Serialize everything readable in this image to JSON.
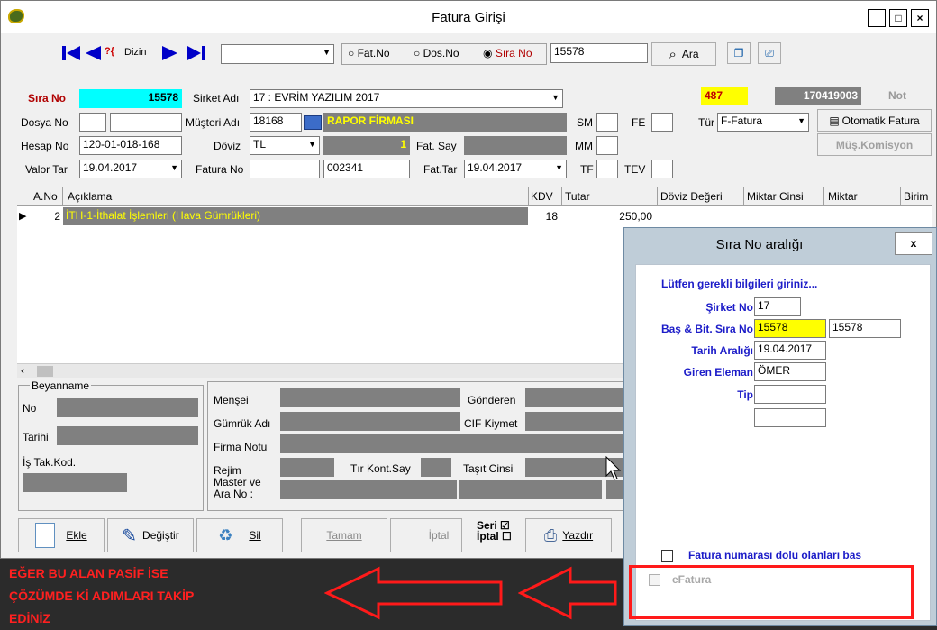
{
  "window": {
    "title": "Fatura Girişi",
    "min": "_",
    "max": "□",
    "close": "×"
  },
  "toolbar": {
    "dizin": "Dizin",
    "search_mode_fatno": "Fat.No",
    "search_mode_dosno": "Dos.No",
    "search_mode_sirano": "Sıra No",
    "search_value": "15578",
    "ara": "Ara"
  },
  "form": {
    "sira_no_label": "Sıra No",
    "sira_no": "15578",
    "sirket_label": "Sirket Adı",
    "sirket": "17 : EVRİM YAZILIM 2017",
    "code_yellow": "487",
    "code_gray": "170419003",
    "not_label": "Not",
    "dosya_label": "Dosya No",
    "musteri_label": "Müşteri Adı",
    "musteri_kod": "18168",
    "musteri_ad": "RAPOR FİRMASI",
    "sm_label": "SM",
    "fe_label": "FE",
    "tur_label": "Tür",
    "tur": "F-Fatura",
    "otomatik_fatura": "Otomatik Fatura",
    "hesap_label": "Hesap No",
    "hesap": "120-01-018-168",
    "doviz_label": "Döviz",
    "doviz": "TL",
    "doviz_val": "1",
    "fatsay_label": "Fat. Say",
    "mm_label": "MM",
    "mus_komisyon": "Müş.Komisyon",
    "valor_label": "Valor Tar",
    "valor": "19.04.2017",
    "fatura_no_label": "Fatura No",
    "fatura_no2": "002341",
    "fat_tar_label": "Fat.Tar",
    "fat_tar": "19.04.2017",
    "tf_label": "TF",
    "tev_label": "TEV"
  },
  "grid": {
    "headers": [
      "A.No",
      "Açıklama",
      "KDV",
      "Tutar",
      "Döviz Değeri",
      "Miktar Cinsi",
      "Miktar",
      "Birim"
    ],
    "row": {
      "ano": "2",
      "aciklama": "İTH-1-İthalat İşlemleri  (Hava Gümrükleri)",
      "kdv": "18",
      "tutar": "250,00"
    }
  },
  "beyanname": {
    "title": "Beyanname",
    "no": "No",
    "tarihi": "Tarihi",
    "is_tak": "İş Tak.Kod.",
    "mensei": "Menşei",
    "gumruk": "Gümrük Adı",
    "firma_notu": "Firma Notu",
    "rejim": "Rejim",
    "master": "Master ve Ara No :",
    "gonderen": "Gönderen",
    "cif": "CIF Kiymet",
    "tir": "Tır Kont.Say",
    "tasit": "Taşıt Cinsi"
  },
  "actions": {
    "ekle": "Ekle",
    "degistir": "Değiştir",
    "sil": "Sil",
    "tamam": "Tamam",
    "iptal": "İptal",
    "seri": "Seri",
    "iptal2": "İptal",
    "yazdir": "Yazdır"
  },
  "note": {
    "line1": "EĞER BU ALAN PASİF İSE",
    "line2": "ÇÖZÜMDE Kİ ADIMLARI TAKİP",
    "line3": "EDİNİZ"
  },
  "dialog": {
    "title": "Sıra No aralığı",
    "close": "x",
    "prompt": "Lütfen gerekli bilgileri  giriniz...",
    "sirket_label": "Şirket No",
    "sirket": "17",
    "bas_bit_label": "Baş & Bit. Sıra No",
    "bas": "15578",
    "bit": "15578",
    "tarih_label": "Tarih Aralığı",
    "tarih": "19.04.2017",
    "giren_label": "Giren Eleman",
    "giren": "ÖMER",
    "tip_label": "Tip",
    "dolu_label": "Fatura numarası  dolu olanları bas",
    "efatura_label": "eFatura"
  },
  "colors": {
    "cyan": "#00ffff",
    "yellow": "#ffff00",
    "highlight": "#ff0000",
    "label_red": "#b00000"
  }
}
